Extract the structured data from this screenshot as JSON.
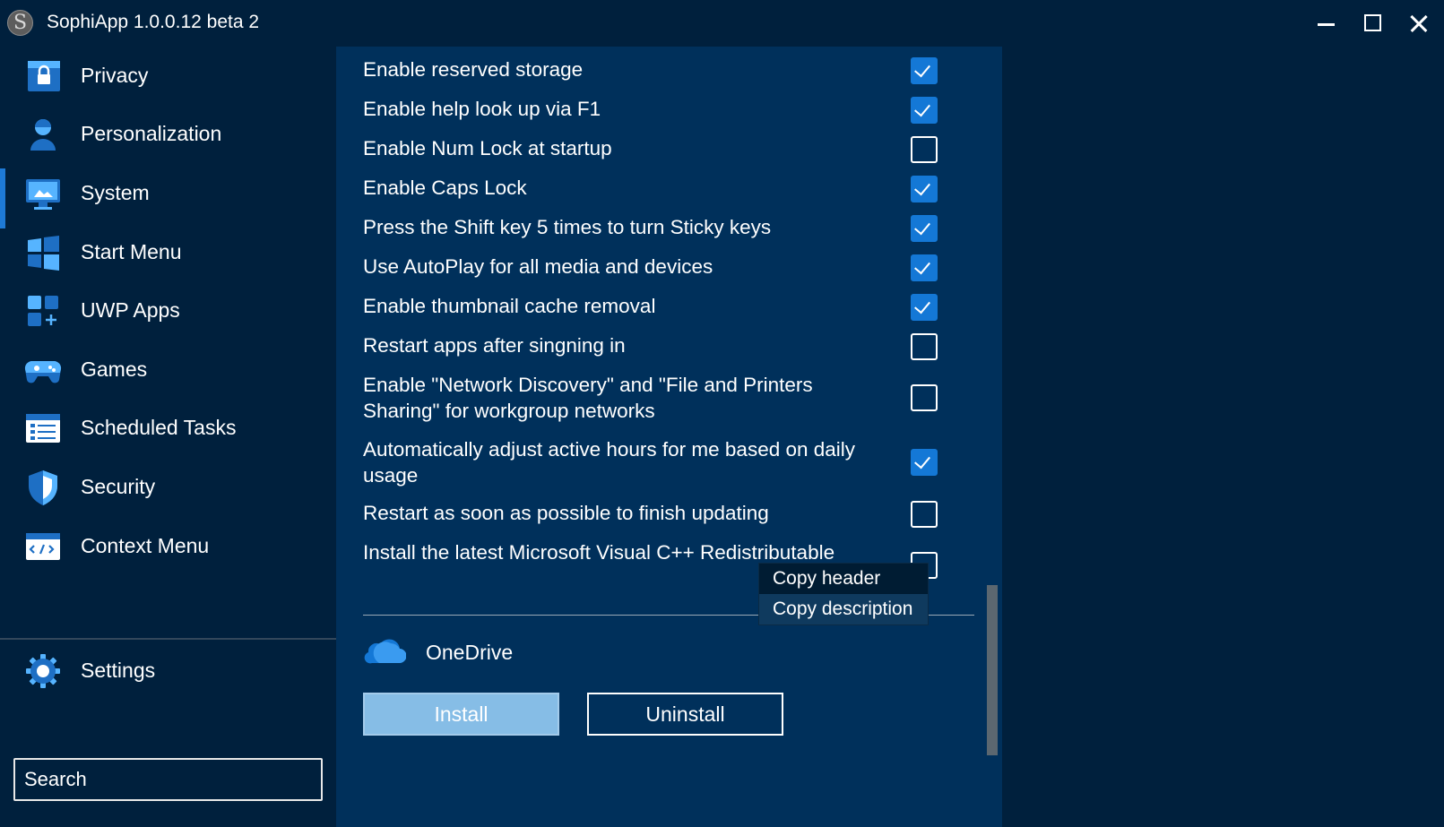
{
  "window": {
    "title": "SophiApp 1.0.0.12 beta 2",
    "logo_letter": "S"
  },
  "sidebar": {
    "items": [
      {
        "label": "Privacy",
        "icon": "privacy-lock-icon"
      },
      {
        "label": "Personalization",
        "icon": "person-icon"
      },
      {
        "label": "System",
        "icon": "monitor-settings-icon",
        "active": true
      },
      {
        "label": "Start Menu",
        "icon": "windows-logo-icon"
      },
      {
        "label": "UWP Apps",
        "icon": "apps-grid-icon"
      },
      {
        "label": "Games",
        "icon": "gamepad-icon"
      },
      {
        "label": "Scheduled Tasks",
        "icon": "task-list-icon"
      },
      {
        "label": "Security",
        "icon": "shield-icon"
      },
      {
        "label": "Context Menu",
        "icon": "code-window-icon"
      }
    ],
    "settings": {
      "label": "Settings",
      "icon": "gear-icon"
    },
    "search_placeholder": "Search"
  },
  "options": [
    {
      "label": "Enable reserved storage",
      "checked": true
    },
    {
      "label": "Enable help look up via F1",
      "checked": true
    },
    {
      "label": "Enable Num Lock at startup",
      "checked": false
    },
    {
      "label": "Enable Caps Lock",
      "checked": true
    },
    {
      "label": "Press the Shift key 5 times to turn Sticky keys",
      "checked": true
    },
    {
      "label": "Use AutoPlay for all media and devices",
      "checked": true
    },
    {
      "label": "Enable thumbnail cache removal",
      "checked": true
    },
    {
      "label": "Restart apps after singning in",
      "checked": false
    },
    {
      "label": "Enable \"Network Discovery\" and \"File and Printers Sharing\" for workgroup networks",
      "checked": false
    },
    {
      "label": "Automatically adjust active hours for me based on daily usage",
      "checked": true
    },
    {
      "label": "Restart as soon as possible to finish updating",
      "checked": false
    },
    {
      "label": "Install the latest Microsoft Visual C++ Redistributable",
      "checked": false
    }
  ],
  "onedrive": {
    "label": "OneDrive",
    "install_label": "Install",
    "uninstall_label": "Uninstall"
  },
  "context_menu": {
    "items": [
      "Copy header",
      "Copy description"
    ],
    "highlighted": "Copy description"
  },
  "colors": {
    "background": "#00203d",
    "content_background": "#00305b",
    "accent": "#1478d6",
    "install_button": "#86bde6"
  }
}
